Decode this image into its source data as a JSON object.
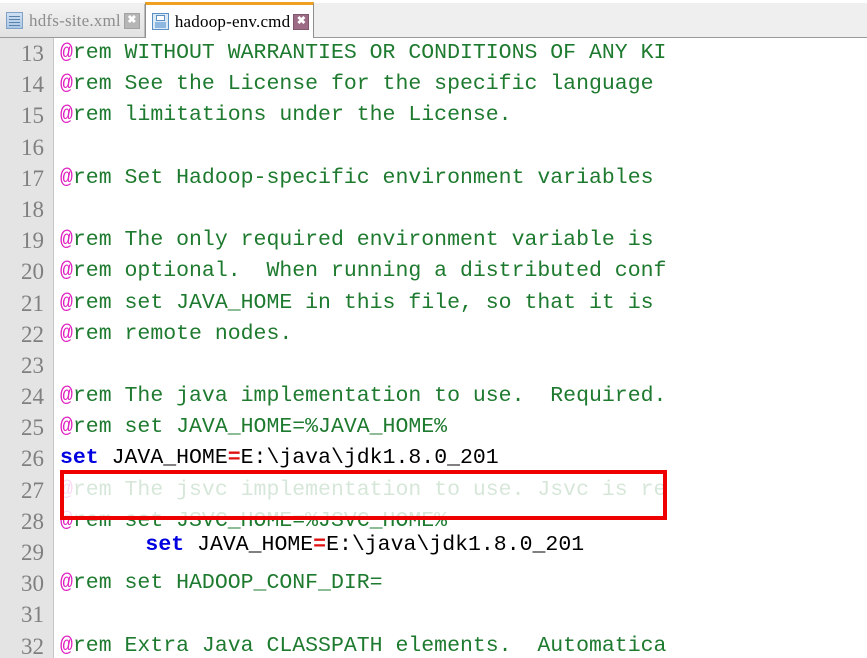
{
  "window": {
    "app_kind": "text-editor",
    "accent_active_tab": "#f0a020",
    "highlight_color": "#ef0000"
  },
  "tabs": [
    {
      "label": "hdfs-site.xml",
      "icon": "xml-file-icon",
      "close_label": "✖",
      "active": false
    },
    {
      "label": "hadoop-env.cmd",
      "icon": "save-file-icon",
      "close_label": "✖",
      "active": true
    }
  ],
  "editor": {
    "gutter": [
      "13",
      "14",
      "15",
      "16",
      "17",
      "18",
      "19",
      "20",
      "21",
      "22",
      "23",
      "24",
      "25",
      "26",
      "27",
      "28",
      "29",
      "30",
      "31",
      "32"
    ],
    "lines": [
      {
        "n": "13",
        "segments": [
          {
            "t": "@",
            "c": "at"
          },
          {
            "t": "rem WITHOUT WARRANTIES OR CONDITIONS OF ANY KI",
            "c": "comment"
          }
        ]
      },
      {
        "n": "14",
        "segments": [
          {
            "t": "@",
            "c": "at"
          },
          {
            "t": "rem See the License for the specific language ",
            "c": "comment"
          }
        ]
      },
      {
        "n": "15",
        "segments": [
          {
            "t": "@",
            "c": "at"
          },
          {
            "t": "rem limitations under the License.",
            "c": "comment"
          }
        ]
      },
      {
        "n": "16",
        "segments": []
      },
      {
        "n": "17",
        "segments": [
          {
            "t": "@",
            "c": "at"
          },
          {
            "t": "rem Set Hadoop-specific environment variables ",
            "c": "comment"
          }
        ]
      },
      {
        "n": "18",
        "segments": []
      },
      {
        "n": "19",
        "segments": [
          {
            "t": "@",
            "c": "at"
          },
          {
            "t": "rem The only required environment variable is ",
            "c": "comment"
          }
        ]
      },
      {
        "n": "20",
        "segments": [
          {
            "t": "@",
            "c": "at"
          },
          {
            "t": "rem optional.  When running a distributed conf",
            "c": "comment"
          }
        ]
      },
      {
        "n": "21",
        "segments": [
          {
            "t": "@",
            "c": "at"
          },
          {
            "t": "rem set JAVA_HOME in this file, so that it is ",
            "c": "comment"
          }
        ]
      },
      {
        "n": "22",
        "segments": [
          {
            "t": "@",
            "c": "at"
          },
          {
            "t": "rem remote nodes.",
            "c": "comment"
          }
        ]
      },
      {
        "n": "23",
        "segments": []
      },
      {
        "n": "24",
        "segments": [
          {
            "t": "@",
            "c": "at"
          },
          {
            "t": "rem The java implementation to use.  Required.",
            "c": "comment"
          }
        ]
      },
      {
        "n": "25",
        "segments": [
          {
            "t": "@",
            "c": "at"
          },
          {
            "t": "rem set JAVA_HOME=%JAVA_HOME%",
            "c": "comment"
          }
        ]
      },
      {
        "n": "26",
        "segments": [
          {
            "t": "set",
            "c": "kw"
          },
          {
            "t": " JAVA_HOME",
            "c": "plain"
          },
          {
            "t": "=",
            "c": "eq"
          },
          {
            "t": "E:\\java\\jdk1.8.0_201",
            "c": "plain"
          }
        ]
      },
      {
        "n": "27",
        "segments": [
          {
            "t": "@",
            "c": "at"
          },
          {
            "t": "rem The jsvc implementation to use. Jsvc is re",
            "c": "comment"
          }
        ]
      },
      {
        "n": "28",
        "segments": [
          {
            "t": "@",
            "c": "at"
          },
          {
            "t": "rem set JSVC_HOME=%JSVC_HOME%",
            "c": "comment"
          }
        ]
      },
      {
        "n": "29",
        "segments": []
      },
      {
        "n": "30",
        "segments": [
          {
            "t": "@",
            "c": "at"
          },
          {
            "t": "rem set HADOOP_CONF_DIR=",
            "c": "comment"
          }
        ]
      },
      {
        "n": "31",
        "segments": []
      },
      {
        "n": "32",
        "segments": [
          {
            "t": "@",
            "c": "at"
          },
          {
            "t": "rem Extra Java CLASSPATH elements.  Automatica",
            "c": "comment"
          }
        ]
      }
    ],
    "highlighted_line": {
      "number": "26",
      "keyword": "set",
      "variable": " JAVA_HOME",
      "operator": "=",
      "value": "E:\\java\\jdk1.8.0_201"
    }
  }
}
